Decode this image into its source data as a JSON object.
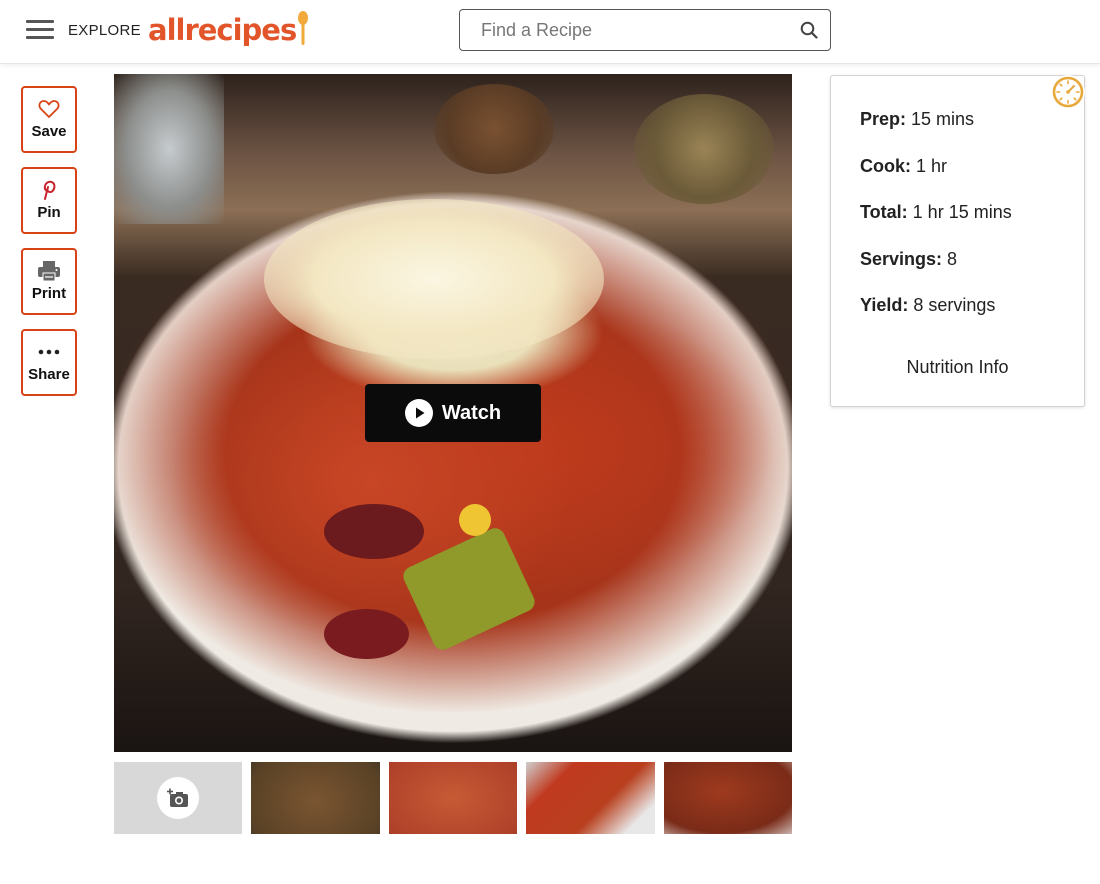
{
  "header": {
    "menu_label": "EXPLORE",
    "logo_text": "allrecipes",
    "search": {
      "placeholder": "Find a Recipe",
      "value": ""
    },
    "brand_color": "#e2552a"
  },
  "actions": [
    {
      "label": "Save",
      "icon": "heart-icon"
    },
    {
      "label": "Pin",
      "icon": "pinterest-icon"
    },
    {
      "label": "Print",
      "icon": "printer-icon"
    },
    {
      "label": "Share",
      "icon": "more-dots-icon"
    }
  ],
  "media": {
    "watch_label": "Watch",
    "thumbnails_count": 4,
    "add_photo_icon": "add-photo-icon"
  },
  "recipe_info": {
    "prep": {
      "label": "Prep:",
      "value": "15 mins"
    },
    "cook": {
      "label": "Cook:",
      "value": "1 hr"
    },
    "total": {
      "label": "Total:",
      "value": "1 hr 15 mins"
    },
    "servings": {
      "label": "Servings:",
      "value": "8"
    },
    "yield": {
      "label": "Yield:",
      "value": "8 servings"
    },
    "nutrition_link": "Nutrition Info",
    "timer_icon": "timer-icon",
    "accent_color": "#e8a83a"
  }
}
